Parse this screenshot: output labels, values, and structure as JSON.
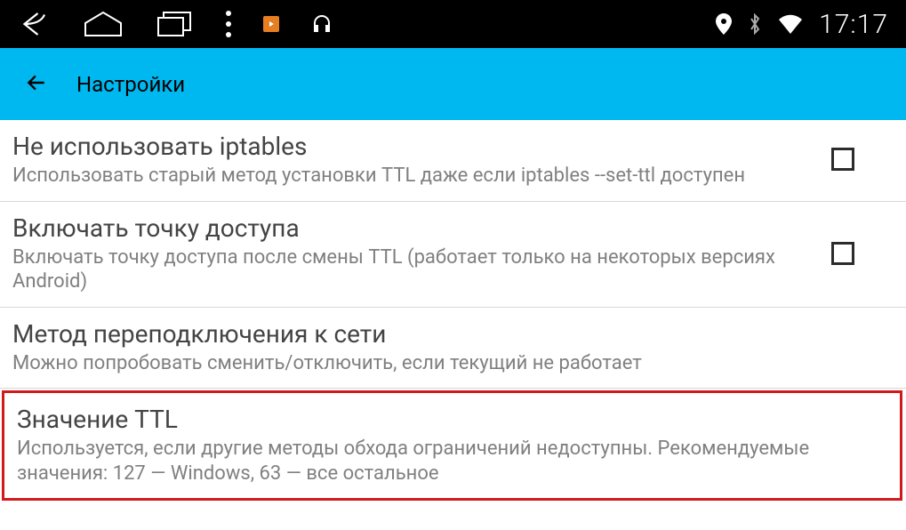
{
  "status_bar": {
    "time": "17:17"
  },
  "app_bar": {
    "title": "Настройки"
  },
  "settings": [
    {
      "title": "Не использовать iptables",
      "subtitle": "Использовать старый метод установки TTL даже если iptables --set-ttl доступен",
      "has_checkbox": true,
      "checked": false
    },
    {
      "title": "Включать точку доступа",
      "subtitle": "Включать точку доступа после смены TTL (работает только на некоторых версиях Android)",
      "has_checkbox": true,
      "checked": false
    },
    {
      "title": "Метод переподключения к сети",
      "subtitle": "Можно попробовать сменить/отключить, если текущий не работает",
      "has_checkbox": false
    },
    {
      "title": "Значение TTL",
      "subtitle": "Используется, если другие методы обхода ограничений недоступны. Рекомендуемые значения: 127 — Windows, 63 — все остальное",
      "has_checkbox": false,
      "highlighted": true
    }
  ]
}
